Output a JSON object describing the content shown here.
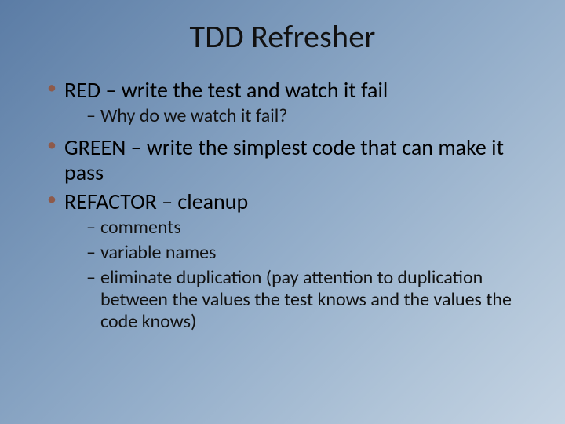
{
  "slide": {
    "title": "TDD Refresher",
    "bullets": [
      {
        "keyword": "RED",
        "rest": " – write the test and watch it fail",
        "sub": [
          "Why do we watch it fail?"
        ]
      },
      {
        "keyword": "GREEN",
        "rest": " – write the simplest code that can make it pass",
        "sub": []
      },
      {
        "keyword": "REFACTOR",
        "rest": " – cleanup",
        "sub": [
          "comments",
          "variable names",
          "eliminate duplication (pay attention to duplication between the values the test knows and the values the code knows)"
        ]
      }
    ]
  }
}
